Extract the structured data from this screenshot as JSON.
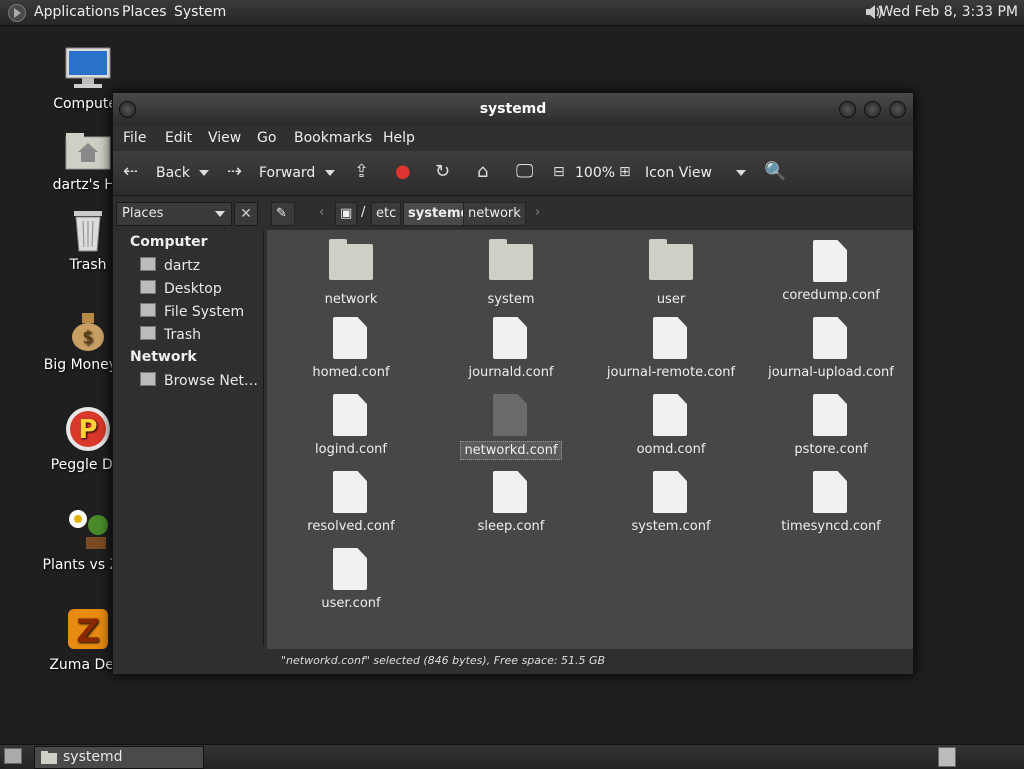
{
  "top_panel": {
    "menus": [
      "Applications",
      "Places",
      "System"
    ],
    "clock": "Wed Feb  8,  3:33 PM"
  },
  "desktop_icons": [
    {
      "label": "Computer",
      "icon": "computer-icon"
    },
    {
      "label": "dartz's Ho",
      "icon": "home-folder-icon"
    },
    {
      "label": "Trash",
      "icon": "trash-icon"
    },
    {
      "label": "Big Money D",
      "icon": "money-bag-icon"
    },
    {
      "label": "Peggle Del",
      "icon": "peggle-icon"
    },
    {
      "label": "Plants vs Zor",
      "icon": "plants-icon"
    },
    {
      "label": "Zuma Delu",
      "icon": "zuma-icon"
    }
  ],
  "window": {
    "title": "systemd",
    "menu": [
      "File",
      "Edit",
      "View",
      "Go",
      "Bookmarks",
      "Help"
    ],
    "toolbar": {
      "back": "Back",
      "forward": "Forward",
      "zoom": "100%",
      "view_mode": "Icon View"
    },
    "location": {
      "places_label": "Places",
      "crumbs": [
        "/",
        "etc",
        "systemd",
        "network"
      ],
      "active": "systemd"
    },
    "sidebar": {
      "computer_header": "Computer",
      "computer_items": [
        "dartz",
        "Desktop",
        "File System",
        "Trash"
      ],
      "network_header": "Network",
      "network_items": [
        "Browse Net…"
      ]
    },
    "files": [
      {
        "name": "network",
        "type": "folder"
      },
      {
        "name": "system",
        "type": "folder"
      },
      {
        "name": "user",
        "type": "folder"
      },
      {
        "name": "coredump.conf",
        "type": "file"
      },
      {
        "name": "homed.conf",
        "type": "file"
      },
      {
        "name": "journald.conf",
        "type": "file"
      },
      {
        "name": "journal-remote.conf",
        "type": "file"
      },
      {
        "name": "journal-upload.conf",
        "type": "file"
      },
      {
        "name": "logind.conf",
        "type": "file"
      },
      {
        "name": "networkd.conf",
        "type": "file",
        "selected": true
      },
      {
        "name": "oomd.conf",
        "type": "file"
      },
      {
        "name": "pstore.conf",
        "type": "file"
      },
      {
        "name": "resolved.conf",
        "type": "file"
      },
      {
        "name": "sleep.conf",
        "type": "file"
      },
      {
        "name": "system.conf",
        "type": "file"
      },
      {
        "name": "timesyncd.conf",
        "type": "file"
      },
      {
        "name": "user.conf",
        "type": "file"
      }
    ],
    "status": "\"networkd.conf\" selected (846 bytes), Free space: 51.5 GB"
  },
  "taskbar": {
    "task_label": "systemd"
  }
}
